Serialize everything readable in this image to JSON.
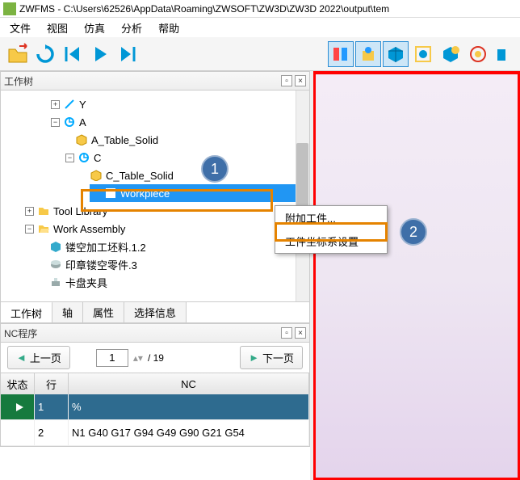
{
  "title": "ZWFMS - C:\\Users\\62526\\AppData\\Roaming\\ZWSOFT\\ZW3D\\ZW3D 2022\\output\\tem",
  "menu": [
    "文件",
    "视图",
    "仿真",
    "分析",
    "帮助"
  ],
  "panels": {
    "tree_title": "工作树",
    "nc_title": "NC程序"
  },
  "tree": {
    "y": "Y",
    "a": "A",
    "a_solid": "A_Table_Solid",
    "c": "C",
    "c_solid": "C_Table_Solid",
    "workpiece": "Workpiece",
    "tool_lib": "Tool Library",
    "work_asm": "Work Assembly",
    "item1": "镂空加工坯料.1.2",
    "item2": "印章镂空零件.3",
    "item3": "卡盘夹具"
  },
  "tabs": [
    "工作树",
    "轴",
    "属性",
    "选择信息"
  ],
  "nc": {
    "prev": "上一页",
    "next": "下一页",
    "page": "1",
    "total": "/  19",
    "col_status": "状态",
    "col_line": "行",
    "col_nc": "NC",
    "row1_line": "1",
    "row1_nc": "%",
    "row2_line": "2",
    "row2_nc": "N1 G40 G17 G94 G49 G90 G21 G54"
  },
  "ctx": {
    "attach": "附加工件...",
    "wcs": "工件坐标系设置"
  },
  "callouts": {
    "c1": "1",
    "c2": "2"
  }
}
